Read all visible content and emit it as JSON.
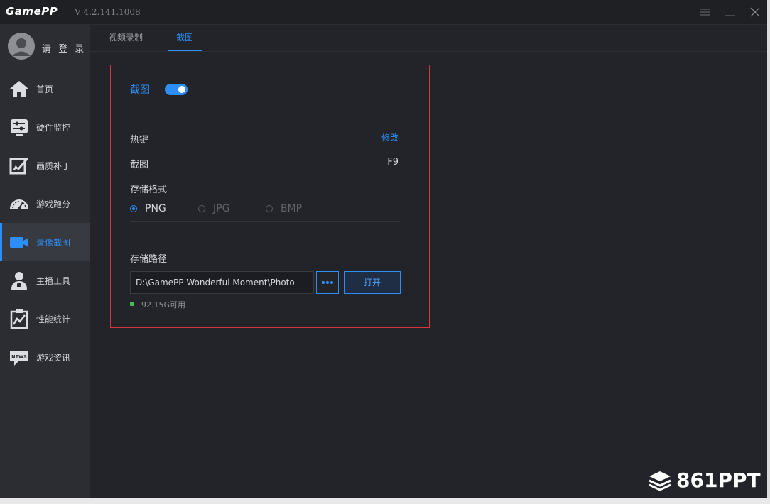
{
  "app": {
    "logo_text": "GamePP",
    "version": "V 4.2.141.1008"
  },
  "user": {
    "login_label": "请 登 录"
  },
  "sidebar": {
    "items": [
      {
        "label": "首页",
        "icon": "home-icon"
      },
      {
        "label": "硬件监控",
        "icon": "hardware-monitor-icon"
      },
      {
        "label": "画质补丁",
        "icon": "image-quality-icon"
      },
      {
        "label": "游戏跑分",
        "icon": "speedometer-icon"
      },
      {
        "label": "录像截图",
        "icon": "video-camera-icon",
        "active": true
      },
      {
        "label": "主播工具",
        "icon": "streamer-icon"
      },
      {
        "label": "性能统计",
        "icon": "performance-chart-icon"
      },
      {
        "label": "游戏资讯",
        "icon": "news-icon"
      }
    ]
  },
  "tabs": [
    {
      "label": "视频录制"
    },
    {
      "label": "截图",
      "active": true
    }
  ],
  "screenshot": {
    "title": "截图",
    "enabled": true,
    "hotkey_label": "热键",
    "edit_link": "修改",
    "hotkey_name": "截图",
    "hotkey_value": "F9",
    "format_label": "存储格式",
    "formats": [
      {
        "label": "PNG",
        "checked": true
      },
      {
        "label": "JPG",
        "checked": false
      },
      {
        "label": "BMP",
        "checked": false
      }
    ],
    "path_label": "存储路径",
    "path_value": "D:\\GamePP Wonderful Moment\\Photo",
    "browse_label": "•••",
    "open_label": "打开",
    "free_space": "92.15G可用"
  },
  "watermark": {
    "text": "861PPT"
  },
  "colors": {
    "accent": "#2c8ef8",
    "window_bg": "#23242a",
    "sidebar_bg": "#2c2d33",
    "highlight_border": "#d8363a",
    "free_indicator": "#3fbf4f"
  }
}
